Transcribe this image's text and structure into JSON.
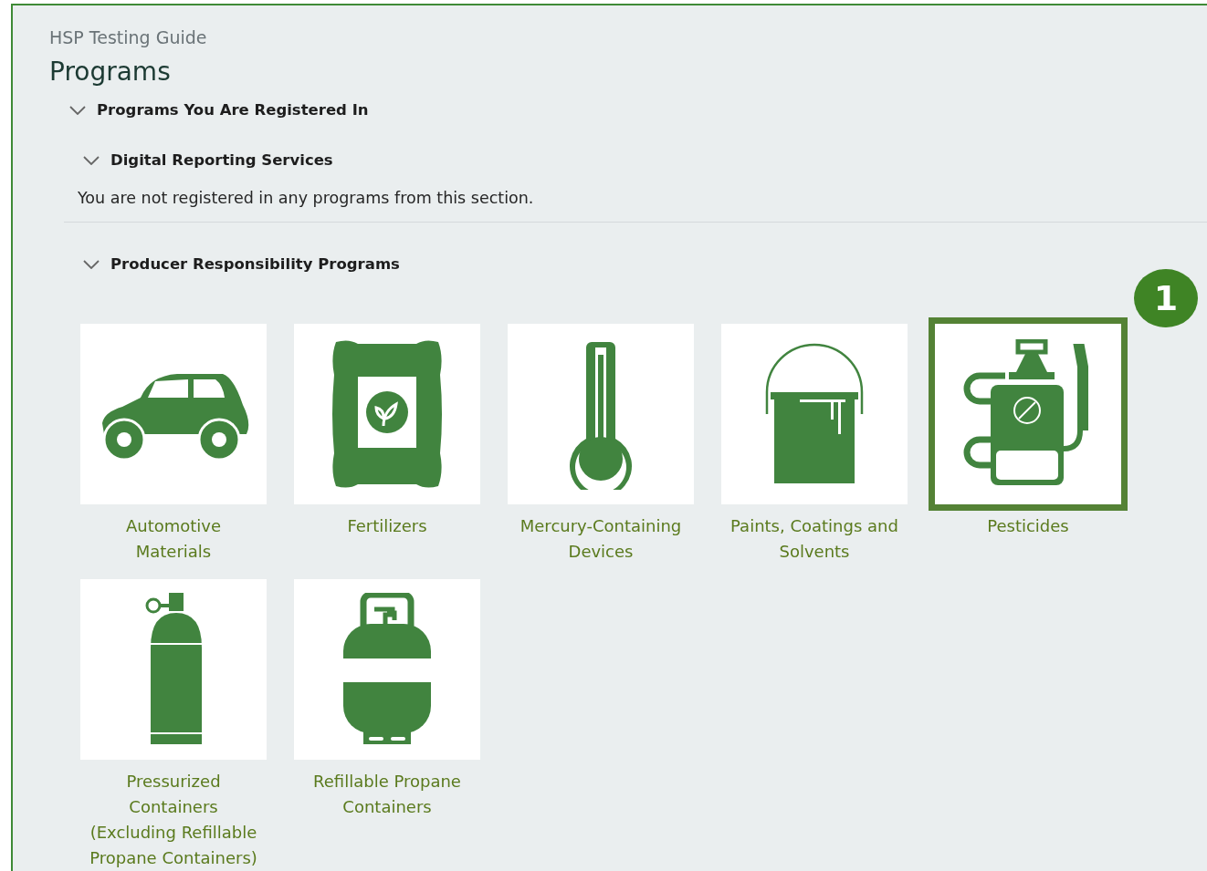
{
  "breadcrumb": "HSP Testing Guide",
  "title": "Programs",
  "sections": [
    {
      "heading": "Programs You Are Registered In",
      "expanded": true,
      "children": [
        {
          "heading": "Digital Reporting Services",
          "expanded": true,
          "message": "You are not registered in any programs from this section."
        },
        {
          "heading": "Producer Responsibility Programs",
          "expanded": true,
          "programs": [
            {
              "label": "Automotive Materials",
              "kind": "car",
              "selected": false
            },
            {
              "label": "Fertilizers",
              "kind": "bag",
              "selected": false
            },
            {
              "label": "Mercury-Containing Devices",
              "kind": "thermometer",
              "selected": false
            },
            {
              "label": "Paints, Coatings and Solvents",
              "kind": "paint",
              "selected": false
            },
            {
              "label": "Pesticides",
              "kind": "sprayer",
              "selected": true,
              "callout": "1"
            },
            {
              "label": "Pressurized Containers (Excluding Refillable Propane Containers)",
              "kind": "cylinder",
              "selected": false
            },
            {
              "label": "Refillable Propane Containers",
              "kind": "propane",
              "selected": false
            }
          ]
        }
      ]
    }
  ]
}
